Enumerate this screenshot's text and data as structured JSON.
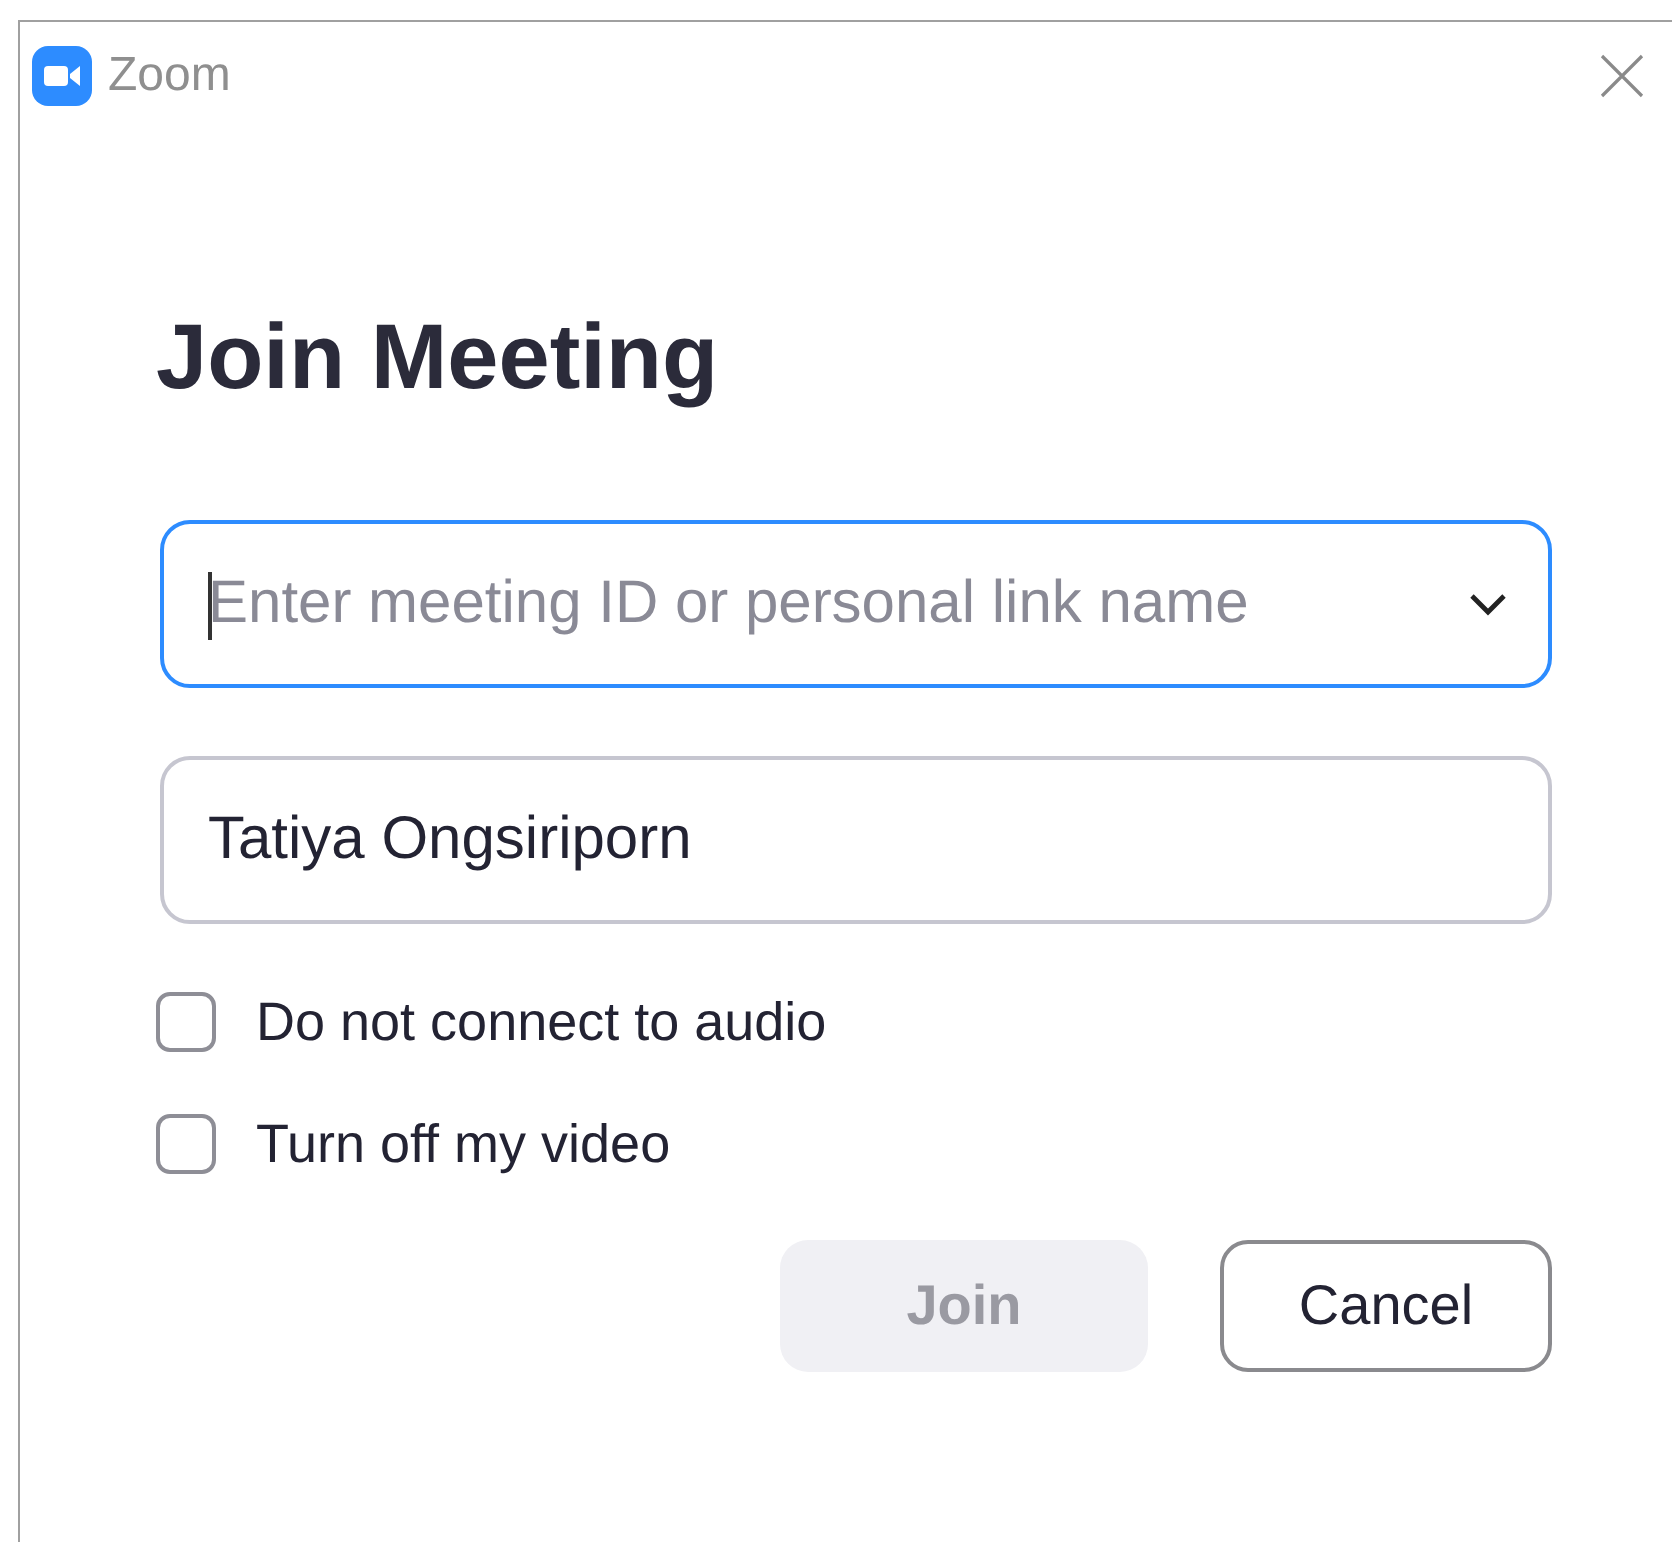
{
  "window": {
    "title": "Zoom"
  },
  "heading": "Join Meeting",
  "fields": [
    {
      "kind": "dropdown",
      "placeholder": "Enter meeting ID or personal link name",
      "focused": true
    },
    {
      "kind": "text",
      "value": "Tatiya Ongsiriporn",
      "focused": false
    }
  ],
  "options": [
    {
      "label": "Do not connect to audio",
      "checked": false
    },
    {
      "label": "Turn off my video",
      "checked": false
    }
  ],
  "buttons": [
    {
      "label": "Join",
      "kind": "primary",
      "disabled": true
    },
    {
      "label": "Cancel",
      "kind": "secondary",
      "disabled": false
    }
  ]
}
